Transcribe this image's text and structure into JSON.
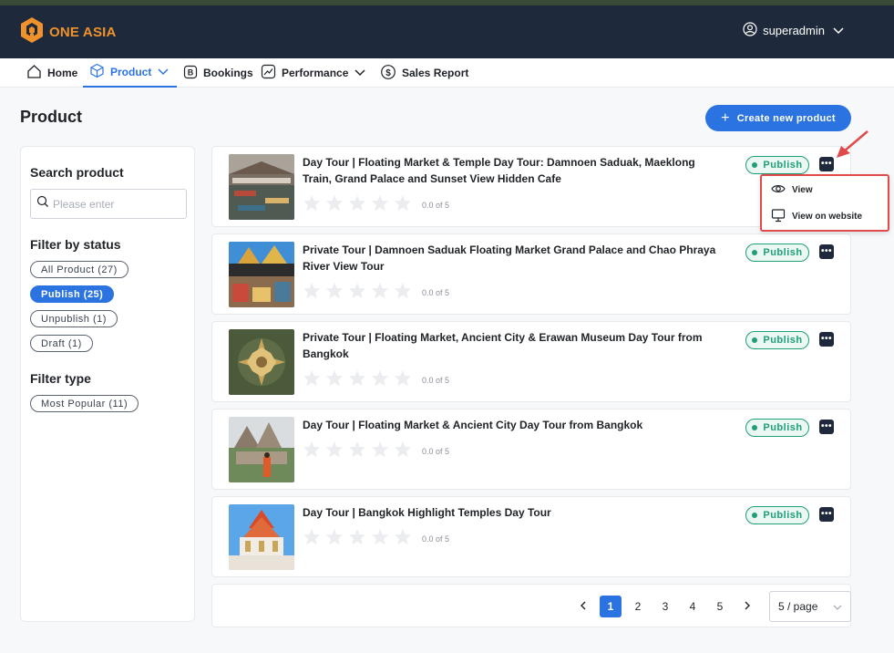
{
  "header": {
    "brand": "ONE ASIA",
    "user_name": "superadmin"
  },
  "nav": {
    "items": [
      {
        "label": "Home",
        "icon": "home-icon"
      },
      {
        "label": "Product",
        "icon": "box-icon",
        "active": true,
        "has_dropdown": true
      },
      {
        "label": "Bookings",
        "icon": "bookings-icon"
      },
      {
        "label": "Performance",
        "icon": "chart-icon",
        "has_dropdown": true
      },
      {
        "label": "Sales Report",
        "icon": "dollar-icon"
      }
    ]
  },
  "page": {
    "title": "Product",
    "create_button": "Create new product"
  },
  "sidebar": {
    "search_heading": "Search product",
    "search_placeholder": "Please enter",
    "status_heading": "Filter by status",
    "status_chips": [
      {
        "label": "All Product (27)",
        "active": false
      },
      {
        "label": "Publish (25)",
        "active": true
      },
      {
        "label": "Unpublish (1)",
        "active": false
      },
      {
        "label": "Draft (1)",
        "active": false
      }
    ],
    "type_heading": "Filter type",
    "type_chips": [
      {
        "label": "Most Popular (11)",
        "active": false
      }
    ]
  },
  "products": [
    {
      "title": "Day Tour | Floating Market & Temple Day Tour: Damnoen Saduak, Maeklong Train, Grand Palace and Sunset View Hidden Cafe",
      "rating": "0.0 of 5",
      "status": "Publish"
    },
    {
      "title": "Private Tour | Damnoen Saduak Floating Market Grand Palace and Chao Phraya River View Tour",
      "rating": "0.0 of 5",
      "status": "Publish"
    },
    {
      "title": "Private Tour | Floating Market, Ancient City & Erawan Museum Day Tour from Bangkok",
      "rating": "0.0 of 5",
      "status": "Publish"
    },
    {
      "title": "Day Tour | Floating Market & Ancient City Day Tour from Bangkok",
      "rating": "0.0 of 5",
      "status": "Publish"
    },
    {
      "title": "Day Tour | Bangkok Highlight Temples Day Tour",
      "rating": "0.0 of 5",
      "status": "Publish"
    }
  ],
  "dropdown_menu": {
    "items": [
      {
        "label": "View",
        "icon": "eye-icon"
      },
      {
        "label": "View on website",
        "icon": "monitor-icon"
      }
    ]
  },
  "pagination": {
    "pages": [
      "1",
      "2",
      "3",
      "4",
      "5"
    ],
    "current": "1",
    "page_size": "5 / page"
  },
  "colors": {
    "header_bg": "#1e2a3b",
    "brand_orange": "#f0922b",
    "primary_blue": "#2b73e0",
    "publish_green": "#1f9e78",
    "annotation_red": "#e04a4a"
  }
}
